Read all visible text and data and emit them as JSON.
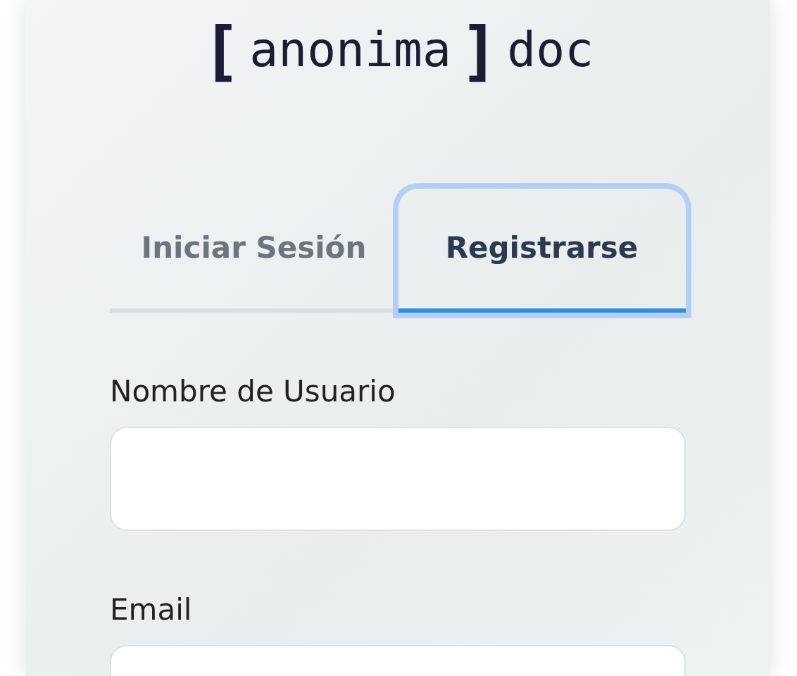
{
  "logo": {
    "open_bracket": "[",
    "name": "anonima",
    "close_bracket": "]",
    "suffix": "doc"
  },
  "tabs": [
    {
      "label": "Iniciar Sesión",
      "selected": false
    },
    {
      "label": "Registrarse",
      "selected": true
    }
  ],
  "fields": [
    {
      "label": "Nombre de Usuario"
    },
    {
      "label": "Email"
    }
  ]
}
